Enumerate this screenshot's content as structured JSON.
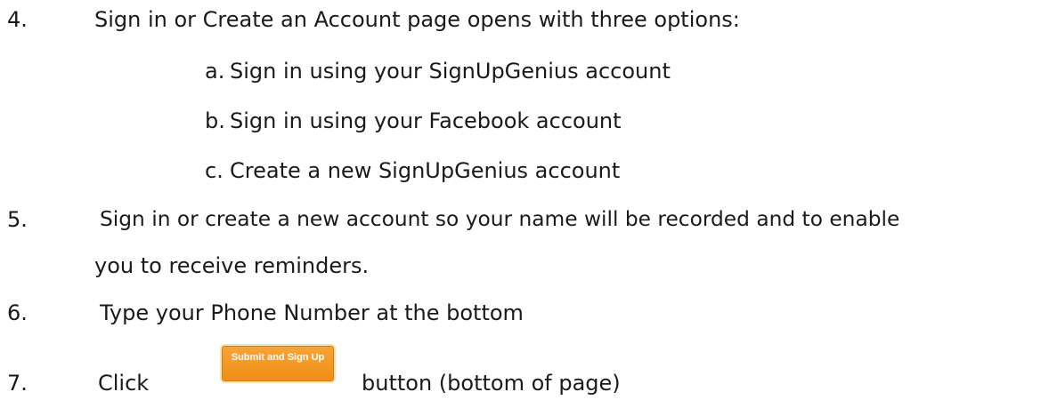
{
  "steps": [
    {
      "number": "4.",
      "text": "Sign in or Create an Account page opens with three options:",
      "options": [
        {
          "letter": "a.",
          "text": "Sign in using your SignUpGenius account"
        },
        {
          "letter": "b.",
          "text": "Sign in using your Facebook account"
        },
        {
          "letter": "c.",
          "text": "Create a new SignUpGenius account"
        }
      ]
    },
    {
      "number": "5.",
      "text_line1": "Sign in or create a new account so your name will be recorded and to enable",
      "text_line2": "you to receive reminders."
    },
    {
      "number": "6.",
      "text": "Type your Phone Number at the bottom"
    },
    {
      "number": "7.",
      "text_before": "Click",
      "button_label": "Submit and Sign Up",
      "text_after": "button (bottom of page)"
    }
  ],
  "colors": {
    "button": "#f39a25",
    "text": "#1a1a1a"
  }
}
